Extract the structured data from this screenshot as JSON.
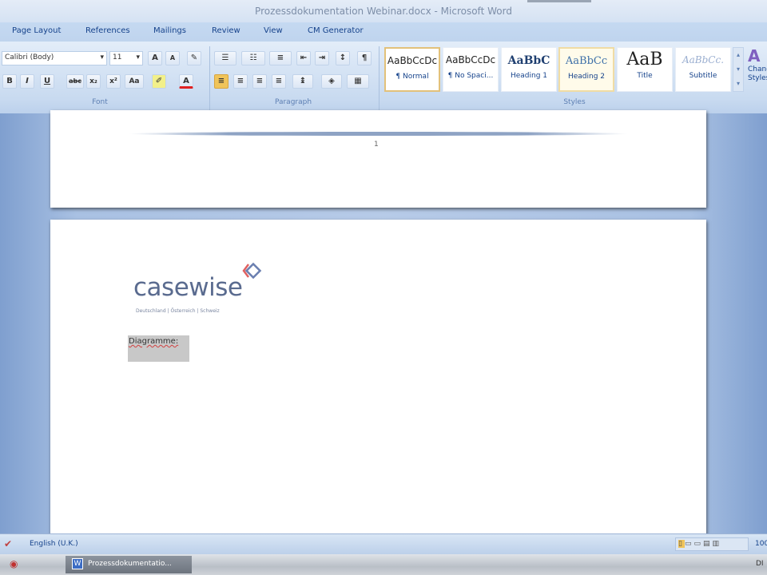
{
  "window": {
    "title": "Prozessdokumentation Webinar.docx - Microsoft Word"
  },
  "tabs": [
    "Page Layout",
    "References",
    "Mailings",
    "Review",
    "View",
    "CM Generator"
  ],
  "font_group": {
    "label": "Font",
    "font_name": "Calibri (Body)",
    "font_size": "11",
    "grow": "A",
    "shrink": "A",
    "bold": "B",
    "italic": "I",
    "underline": "U",
    "strike": "abc",
    "subscript": "x₂",
    "superscript": "x²",
    "change_case": "Aa"
  },
  "paragraph_group": {
    "label": "Paragraph",
    "pilcrow": "¶"
  },
  "styles_group": {
    "label": "Styles",
    "items": [
      {
        "preview": "AaBbCcDc",
        "name": "¶ Normal",
        "selected": true
      },
      {
        "preview": "AaBbCcDc",
        "name": "¶ No Spaci..."
      },
      {
        "preview": "AaBbC",
        "name": "Heading 1"
      },
      {
        "preview": "AaBbCc",
        "name": "Heading 2",
        "hover": true
      },
      {
        "preview": "AaB",
        "name": "Title"
      },
      {
        "preview": "AaBbCc.",
        "name": "Subtitle"
      }
    ],
    "change_styles": "Change Styles"
  },
  "document": {
    "page_number": "1",
    "logo_text": "casewise",
    "logo_tagline": "Deutschland | Österreich | Schweiz",
    "selected_text": "Diagramme:"
  },
  "status": {
    "language": "English (U.K.)",
    "zoom": "100"
  },
  "taskbar": {
    "item": "Prozessdokumentatio...",
    "clock": "DI"
  },
  "colors": {
    "accent": "#15428b",
    "logo": "#5a6b8f",
    "highlight": "#c8c8c8"
  }
}
